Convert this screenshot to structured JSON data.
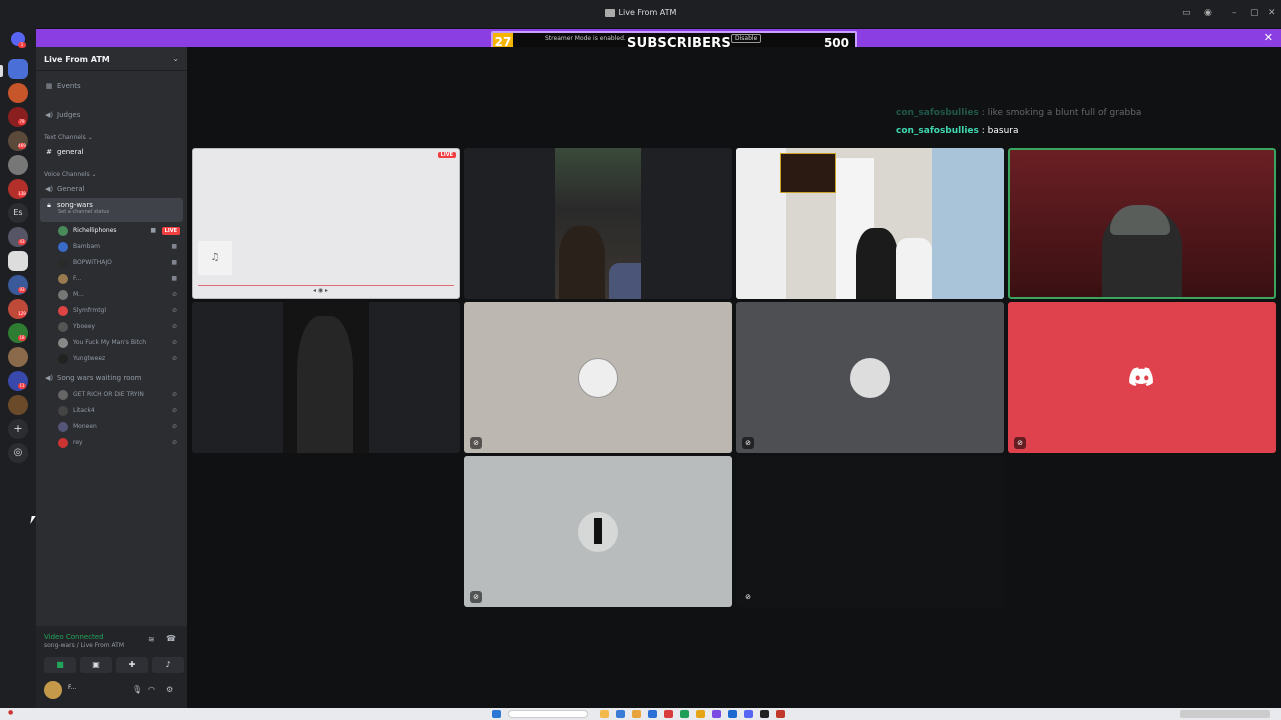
{
  "window": {
    "title": "Live From ATM"
  },
  "banner": {
    "sub_count": "27",
    "label": "SUBSCRIBERS",
    "goal": "500",
    "streamer_text": "Streamer Mode is enabled.",
    "disable_label": "Disable",
    "accent": "#8b3fe3"
  },
  "server": {
    "name": "Live From ATM",
    "events_label": "Events",
    "judges_label": "Judges",
    "text_category": "Text Channels",
    "general_text": "general",
    "voice_category": "Voice Channels",
    "general_voice": "General",
    "active_channel": "song-wars",
    "channel_status": "Set a channel status",
    "waiting_room": "Song wars waiting room"
  },
  "voice_users": [
    {
      "name": "Richelliphones",
      "live": "LIVE",
      "color": "#4a8a5a"
    },
    {
      "name": "Bambam",
      "color": "#3a6bc9"
    },
    {
      "name": "BOPWITHAJO",
      "color": "#2a2a2a"
    },
    {
      "name": "F...",
      "color": "#9a7b4f"
    },
    {
      "name": "M...",
      "color": "#777"
    },
    {
      "name": "Slymfrmtgl",
      "color": "#d44"
    },
    {
      "name": "Yboeey",
      "color": "#555"
    },
    {
      "name": "You Fuck My Man's Bitch",
      "color": "#888"
    },
    {
      "name": "Yungtweez",
      "color": "#222"
    }
  ],
  "waiting_users": [
    {
      "name": "GET RICH OR DIE TRYIN",
      "color": "#666"
    },
    {
      "name": "Litack4",
      "color": "#444"
    },
    {
      "name": "Moneen",
      "color": "#557"
    },
    {
      "name": "rey",
      "color": "#c33"
    }
  ],
  "guild_badges": [
    "1",
    "79",
    "469",
    "138",
    "43",
    "93",
    "129",
    "18",
    "11"
  ],
  "chat_messages": [
    {
      "user": "con_safosbullies",
      "text": "like smoking a blunt full of grabba"
    },
    {
      "user": "con_safosbullies",
      "text": "basura"
    }
  ],
  "voice_panel": {
    "status": "Video Connected",
    "location": "song-wars / Live From ATM",
    "username": "F..."
  },
  "tile_live_badge": "LIVE",
  "colors": {
    "discord_red": "#e0424d",
    "live_red": "#f23f42",
    "connected_green": "#23a559"
  }
}
